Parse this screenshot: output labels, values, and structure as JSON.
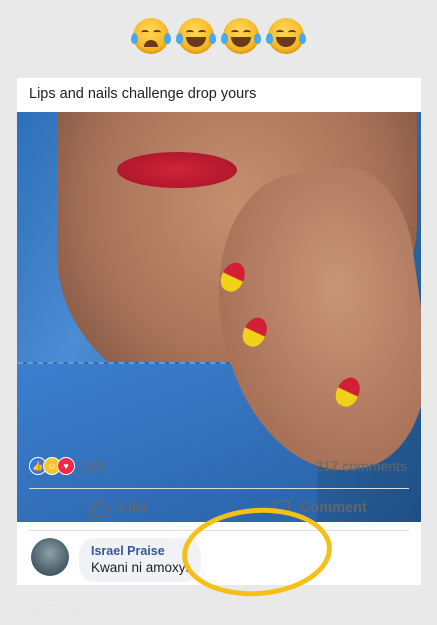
{
  "header": {
    "emojis": [
      "crying-face-icon",
      "tears-of-joy-icon",
      "tears-of-joy-icon",
      "tears-of-joy-icon"
    ]
  },
  "post": {
    "text": "Lips and nails challenge drop yours",
    "reaction_count": "188",
    "comments_count": "217 comments",
    "actions": {
      "like": "Like",
      "comment": "Comment"
    }
  },
  "comment": {
    "author": "Israel Praise",
    "text": "Kwani ni amoxyl"
  },
  "watermark": "@chmwenda",
  "colors": {
    "highlight_circle": "#f4c018",
    "link_blue": "#385898"
  }
}
